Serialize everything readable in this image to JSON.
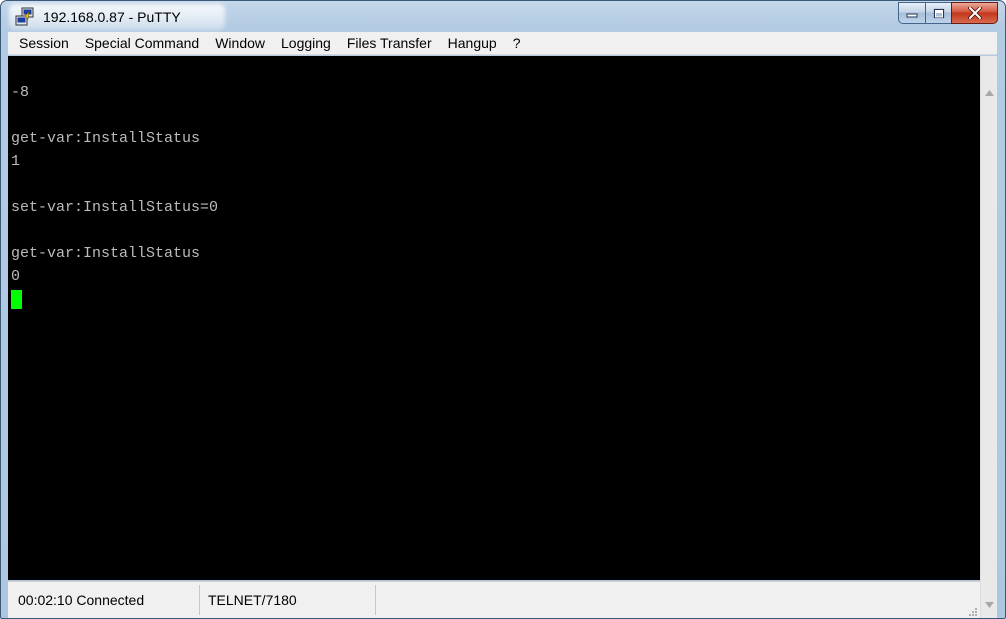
{
  "window": {
    "title": "192.168.0.87 - PuTTY"
  },
  "menu": {
    "items": [
      {
        "label": "Session"
      },
      {
        "label": "Special Command"
      },
      {
        "label": "Window"
      },
      {
        "label": "Logging"
      },
      {
        "label": "Files Transfer"
      },
      {
        "label": "Hangup"
      },
      {
        "label": "?"
      }
    ]
  },
  "terminal": {
    "lines": [
      "",
      "-8",
      "",
      "get-var:InstallStatus",
      "1",
      "",
      "set-var:InstallStatus=0",
      "",
      "get-var:InstallStatus",
      "0"
    ],
    "text_color": "#bbbbbb",
    "cursor_color": "#00ff00",
    "background": "#000000"
  },
  "status": {
    "connection": "00:02:10 Connected",
    "protocol": "TELNET/7180",
    "extra": ""
  },
  "icons": {
    "app": "putty-icon",
    "minimize": "minimize-icon",
    "maximize": "maximize-icon",
    "close": "close-icon",
    "scroll_up": "arrow-up-icon",
    "scroll_down": "arrow-down-icon",
    "grip": "resize-grip-icon"
  }
}
